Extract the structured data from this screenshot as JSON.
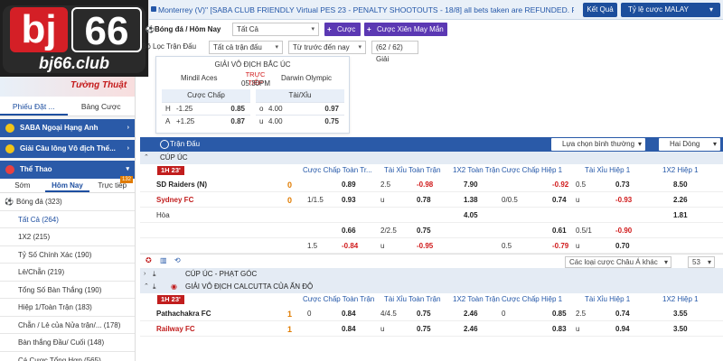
{
  "logo": {
    "brand_a": "bj",
    "brand_b": "66",
    "domain": "bj66.club"
  },
  "topbar": {
    "announcement": "Monterrey (V)\" [SABA CLUB FRIENDLY Virtual PES 23 - PENALTY SHOOTOUTS - 18/8] all bets taken are REFUNDED. Parlay",
    "results_label": "Kết Quả",
    "odds_label": "Tỷ lệ cược MALAY"
  },
  "filters": {
    "date_label": "Bóng đá / Hôm Nay",
    "all_select": "Tất Cả",
    "parlay_btn": "Cược Xiên",
    "lucky_parlay_btn": "Cược Xiên May Mắn",
    "league_filter": "Bộ Lọc Trận Đấu",
    "all_matches": "Tất cả trận đấu",
    "sort_select": "Từ trước đến nay",
    "count": "(62 / 62) Giải"
  },
  "match_card": {
    "league": "GIẢI VÔ ĐỊCH BẮC ÚC",
    "home": "Mindil Aces",
    "away": "Darwin Olympic",
    "live": "TRỰC TIẾP",
    "time": "05:30PM",
    "handicap_header": "Cược Chấp",
    "ou_header": "Tài/Xỉu",
    "handicap": [
      {
        "side": "H",
        "line": "-1.25",
        "odd": "0.85"
      },
      {
        "side": "A",
        "line": "+1.25",
        "odd": "0.87"
      }
    ],
    "ou": [
      {
        "side": "o",
        "line": "4.00",
        "odd": "0.97"
      },
      {
        "side": "u",
        "line": "4.00",
        "odd": "0.75"
      }
    ]
  },
  "sidebar": {
    "banner_text": "Tường Thuật",
    "tab_bet": "Phiếu Đặt ...",
    "tab_board": "Bảng Cược",
    "sections": [
      {
        "label": "SABA Ngoại Hạng Anh"
      },
      {
        "label": "Giải Câu lông Vô địch Thế..."
      },
      {
        "label": "Thể Thao"
      }
    ],
    "subtabs": [
      "Sớm",
      "Hôm Nay",
      "Trực tiếp"
    ],
    "live_count": "132",
    "sport": "Bóng đá",
    "sport_count": "(323)",
    "items": [
      "Tất Cả (264)",
      "1X2 (215)",
      "Tỷ Số Chính Xác (190)",
      "Lẻ/Chẵn (219)",
      "Tổng Số Bàn Thắng (190)",
      "Hiệp 1/Toàn Trận (183)",
      "Chẵn / Lẻ của Nửa trận/...   (178)",
      "Bàn thắng Đầu/ Cuối (148)",
      "Cá Cược Tổng Hợp (565)"
    ]
  },
  "main": {
    "section_title": "Trận Đấu",
    "sort_dd": "Lựa chọn bình thường",
    "lines_dd": "Hai Dòng",
    "league1": "CÚP ÚC",
    "columns": [
      "Cược Chấp Toàn Tr...",
      "Tài Xỉu Toàn Trận",
      "1X2 Toàn Trận",
      "Cược Chấp Hiệp 1",
      "Tài Xỉu Hiệp 1",
      "1X2 Hiệp 1"
    ],
    "columns2": [
      "Cược Chấp Toàn Trận",
      "Tài Xỉu Toàn Trận",
      "1X2 Toàn Trận",
      "Cược Chấp Hiệp 1",
      "Tài Xỉu Hiệp 1",
      "1X2 Hiệp 1"
    ],
    "live_badge": "1H 23'",
    "match1": {
      "home": "SD Raiders (N)",
      "away": "Sydney FC",
      "draw": "Hòa",
      "home_score": "0",
      "away_score": "0",
      "rows": [
        [
          "",
          "0.89",
          "2.5",
          "-0.98",
          "7.90",
          "",
          "-0.92",
          "0.5",
          "0.73",
          "8.50"
        ],
        [
          "1/1.5",
          "0.93",
          "u",
          "0.78",
          "1.38",
          "0/0.5",
          "0.74",
          "u",
          "-0.93",
          "2.26"
        ],
        [
          "",
          "",
          "",
          "",
          "4.05",
          "",
          "",
          "",
          "",
          "1.81"
        ],
        [
          "",
          "0.66",
          "2/2.5",
          "0.75",
          "",
          "",
          "0.61",
          "0.5/1",
          "-0.90",
          ""
        ],
        [
          "1.5",
          "-0.84",
          "u",
          "-0.95",
          "",
          "0.5",
          "-0.79",
          "u",
          "0.70",
          ""
        ]
      ]
    },
    "other_types": "Các loại cược Châu Á khác",
    "count_53": "53",
    "league2": "CÚP ÚC - PHẠT GÓC",
    "league3": "GIẢI VÔ ĐỊCH CALCUTTA CỦA ẤN ĐỘ",
    "match2": {
      "home": "Pathachakra FC",
      "away": "Railway FC",
      "home_score": "1",
      "away_score": "1",
      "rows": [
        [
          "0",
          "0.84",
          "4/4.5",
          "0.75",
          "2.46",
          "0",
          "0.85",
          "2.5",
          "0.74",
          "3.55"
        ],
        [
          "",
          "0.84",
          "u",
          "0.75",
          "2.46",
          "",
          "0.83",
          "u",
          "0.94",
          "3.50"
        ]
      ]
    }
  }
}
